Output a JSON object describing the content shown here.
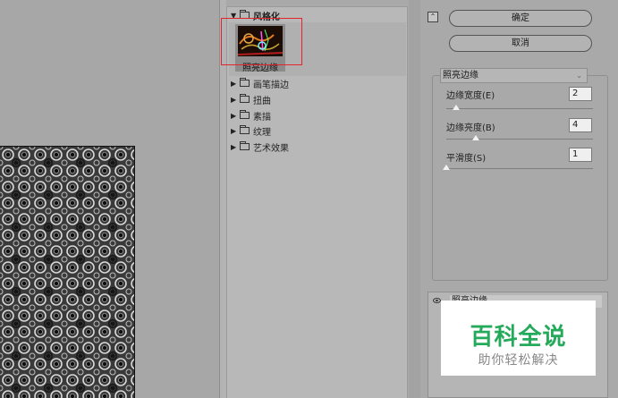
{
  "gallery": {
    "categories": [
      {
        "label": "风格化",
        "expanded": true
      },
      {
        "label": "画笔描边",
        "expanded": false
      },
      {
        "label": "扭曲",
        "expanded": false
      },
      {
        "label": "素描",
        "expanded": false
      },
      {
        "label": "纹理",
        "expanded": false
      },
      {
        "label": "艺术效果",
        "expanded": false
      }
    ],
    "selected_filter": "照亮边缘",
    "highlight_color": "#e2242c"
  },
  "icons": {
    "expanded": "▼",
    "collapsed": "▶",
    "dropdown": "⌄",
    "collapse": "⌃"
  },
  "buttons": {
    "ok": "确定",
    "cancel": "取消"
  },
  "settings": {
    "filter_select": "照亮边缘",
    "params": [
      {
        "label": "边缘宽度(E)",
        "value": "2",
        "level": 0.07
      },
      {
        "label": "边缘亮度(B)",
        "value": "4",
        "level": 0.2
      },
      {
        "label": "平滑度(S)",
        "value": "1",
        "level": 0.0
      }
    ]
  },
  "layers": {
    "active_layer": "照亮边缘"
  },
  "watermark": {
    "title": "百科全说",
    "subtitle": "助你轻松解决",
    "color": "#25a95a"
  }
}
